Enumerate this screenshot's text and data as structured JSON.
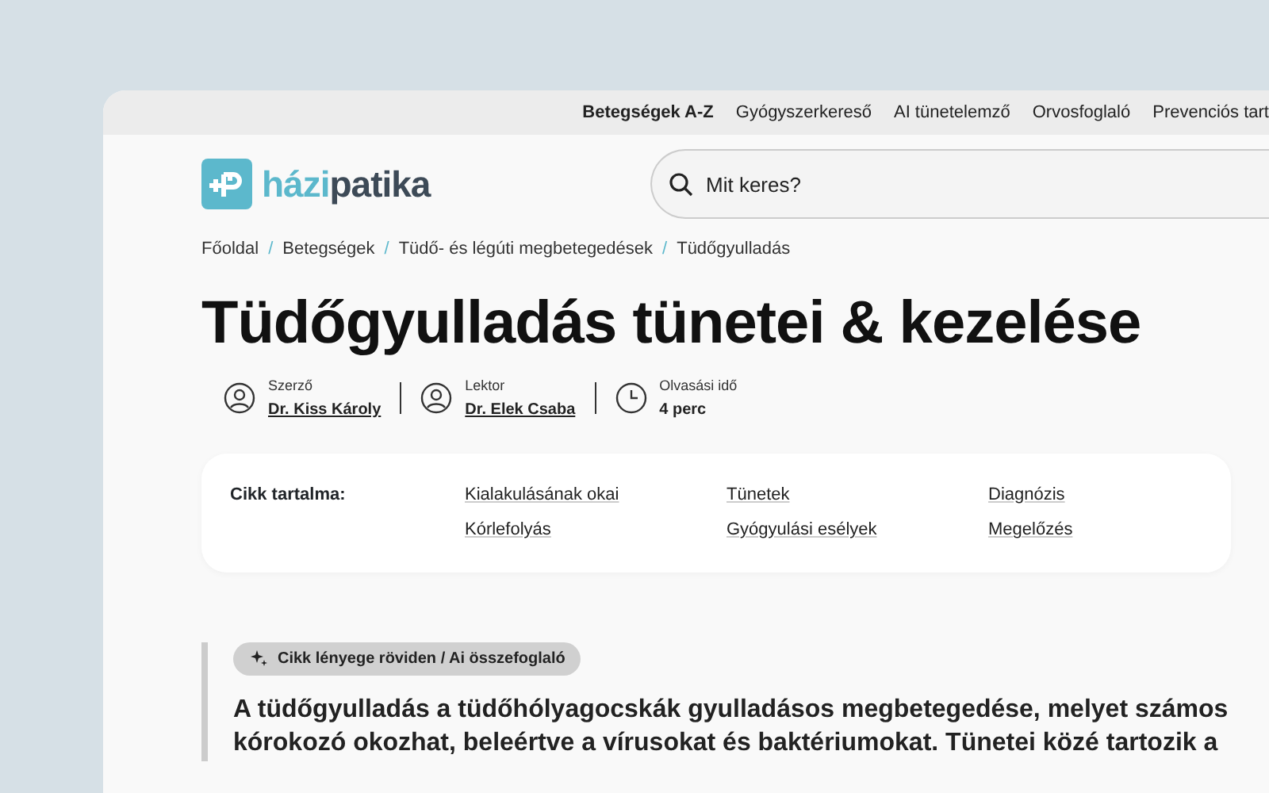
{
  "top_nav": [
    {
      "label": "Betegségek A-Z",
      "selected": true
    },
    {
      "label": "Gyógyszerkereső",
      "selected": false
    },
    {
      "label": "AI tünetelemző",
      "selected": false
    },
    {
      "label": "Orvosfoglaló",
      "selected": false
    },
    {
      "label": "Prevenciós tart",
      "selected": false
    }
  ],
  "logo": {
    "part_1": "házi",
    "part_2": "patika"
  },
  "search": {
    "placeholder": "Mit keres?"
  },
  "breadcrumb": [
    "Főoldal",
    "Betegségek",
    "Tüdő- és légúti megbetegedések",
    "Tüdőgyulladás"
  ],
  "breadcrumb_separator": "/",
  "title": "Tüdőgyulladás tünetei & kezelése",
  "meta": [
    {
      "kind": "person",
      "label": "Szerző",
      "value": "Dr. Kiss Károly",
      "link": true
    },
    {
      "kind": "person",
      "label": "Lektor",
      "value": "Dr. Elek Csaba",
      "link": true
    },
    {
      "kind": "clock",
      "label": "Olvasási idő",
      "value": "4 perc",
      "link": false
    }
  ],
  "toc": {
    "label": "Cikk tartalma:",
    "items": [
      "Kialakulásának okai",
      "Tünetek",
      "Diagnózis",
      "Kórlefolyás",
      "Gyógyulási esélyek",
      "Megelőzés"
    ]
  },
  "summary": {
    "badge": "Cikk lényege röviden / Ai összefoglaló",
    "text": "A tüdőgyulladás a tüdőhólyagocskák gyulladásos megbetegedése, melyet számos kórokozó okozhat, beleértve a vírusokat és baktériumokat. Tünetei közé tartozik a"
  }
}
